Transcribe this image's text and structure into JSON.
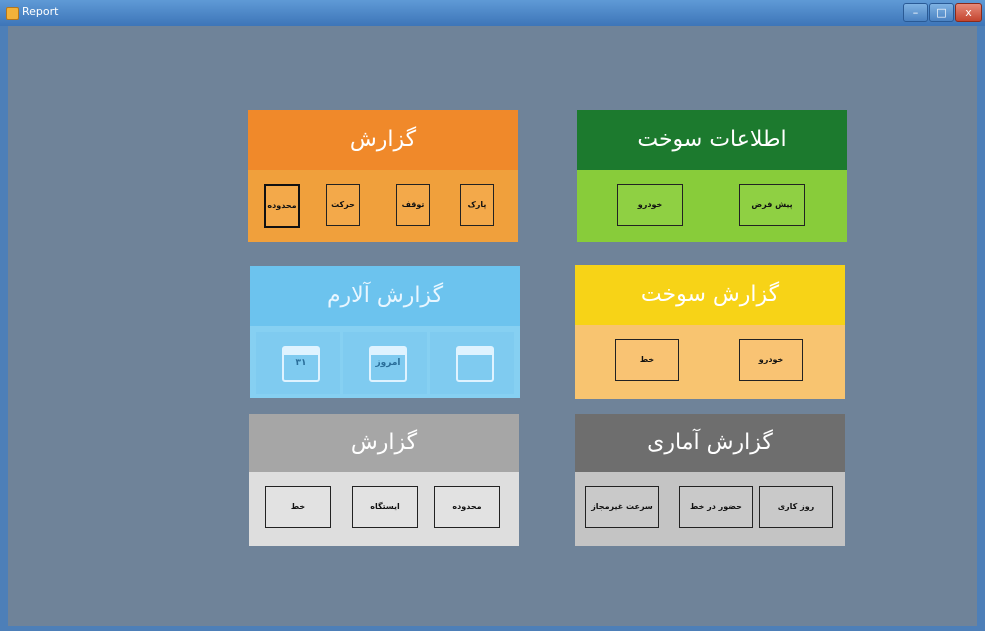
{
  "window": {
    "title": "Report",
    "controls": {
      "min": "–",
      "max": "□",
      "close": "x"
    }
  },
  "cards": {
    "report": {
      "title": "گزارش",
      "buttons": [
        "پارک",
        "توقف",
        "حرکت",
        "محدوده"
      ]
    },
    "fuel_info": {
      "title": "اطلاعات سوخت",
      "buttons": [
        "پیش فرض",
        "خودرو"
      ]
    },
    "alarm_report": {
      "title": "گزارش آلارم",
      "buttons": [
        "۳۱",
        "امروز",
        ""
      ]
    },
    "fuel_report": {
      "title": "گزارش سوخت",
      "buttons": [
        "خودرو",
        "خط"
      ]
    },
    "report2": {
      "title": "گزارش",
      "buttons": [
        "محدوده",
        "ایستگاه",
        "خط"
      ]
    },
    "stat_report": {
      "title": "گزارش آماری",
      "buttons": [
        "روز کاری",
        "حضور در خط",
        "سرعت غیرمجاز"
      ]
    }
  }
}
